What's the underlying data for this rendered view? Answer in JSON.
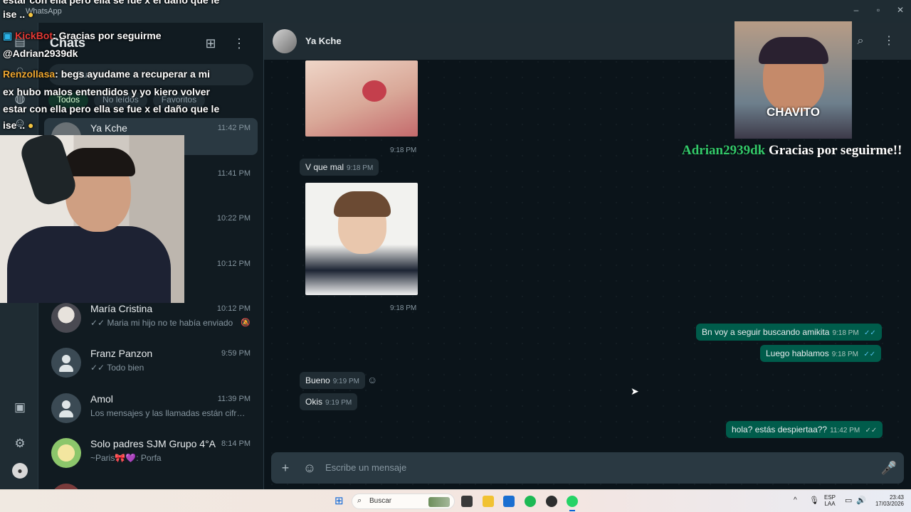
{
  "window": {
    "app_title": "WhatsApp",
    "controls": {
      "minimize": "–",
      "maximize": "▫",
      "close": "✕"
    }
  },
  "rail": {
    "icons": [
      "chats-icon",
      "status-icon",
      "channels-icon",
      "communities-icon",
      "media-icon",
      "settings-icon",
      "profile-icon"
    ]
  },
  "sidebar": {
    "title": "Chats",
    "search_placeholder": "Buscar",
    "filters": [
      "Todos",
      "No leídos",
      "Favoritos"
    ],
    "chats": [
      {
        "name": "Ya Kche",
        "time": "11:42 PM",
        "preview": "??"
      },
      {
        "name": "",
        "time": "11:41 PM",
        "preview": ""
      },
      {
        "name": "",
        "time": "10:22 PM",
        "preview": ""
      },
      {
        "name": "",
        "time": "10:12 PM",
        "preview": ""
      },
      {
        "name": "María Cristina",
        "time": "10:12 PM",
        "preview": "✓✓ Maria mi hijo no te había enviado"
      },
      {
        "name": "Franz Panzon",
        "time": "9:59 PM",
        "preview": "✓✓ Todo bien"
      },
      {
        "name": "Amol",
        "time": "11:39 PM",
        "preview": "Los mensajes y las llamadas están cifr…"
      },
      {
        "name": "Solo padres SJM Grupo 4°A",
        "time": "8:14 PM",
        "preview": "~Paris🎀💜: Porfa"
      }
    ]
  },
  "chat": {
    "contact": "Ya Kche",
    "messages": [
      {
        "dir": "in",
        "kind": "image",
        "time": "9:18 PM"
      },
      {
        "dir": "in",
        "kind": "text",
        "text": "V que mal",
        "time": "9:18 PM"
      },
      {
        "dir": "in",
        "kind": "image",
        "time": "9:18 PM"
      },
      {
        "dir": "out",
        "kind": "text",
        "text": "Bn voy a seguir buscando amikita",
        "time": "9:18 PM"
      },
      {
        "dir": "out",
        "kind": "text",
        "text": "Luego hablamos",
        "time": "9:18 PM"
      },
      {
        "dir": "in",
        "kind": "text",
        "text": "Bueno",
        "time": "9:19 PM"
      },
      {
        "dir": "in",
        "kind": "text",
        "text": "Okis",
        "time": "9:19 PM"
      },
      {
        "dir": "out",
        "kind": "text",
        "text": "hola? estás despiertaa??",
        "time": "11:42 PM"
      }
    ],
    "composer_placeholder": "Escribe un mensaje",
    "ticks": "✓✓"
  },
  "overlay": {
    "line_top": "estar con ella pero ella se fue x el daño que le",
    "line_ise": "ise ..",
    "kickbot_user": "KickBot",
    "kickbot_msg": ": Gracias por seguirme",
    "kickbot_handle": "@Adrian2939dk",
    "renzo_user": "Renzollasa",
    "renzo_msg": ": begs ayudame a recuperar a mi",
    "renzo_line2": "ex hubo malos entendidos y yo kiero volver",
    "renzo_line3": "estar con ella pero ella se fue x el daño que le",
    "renzo_line4": "ise ..",
    "chavito_label": "CHAVITO",
    "thanks_user": "Adrian2939dk",
    "thanks_msg": " Gracias por seguirme!!"
  },
  "taskbar": {
    "search_label": "Buscar",
    "lang_top": "ESP",
    "lang_bottom": "LAA",
    "time": "23:43",
    "date": "17/03/2026"
  }
}
